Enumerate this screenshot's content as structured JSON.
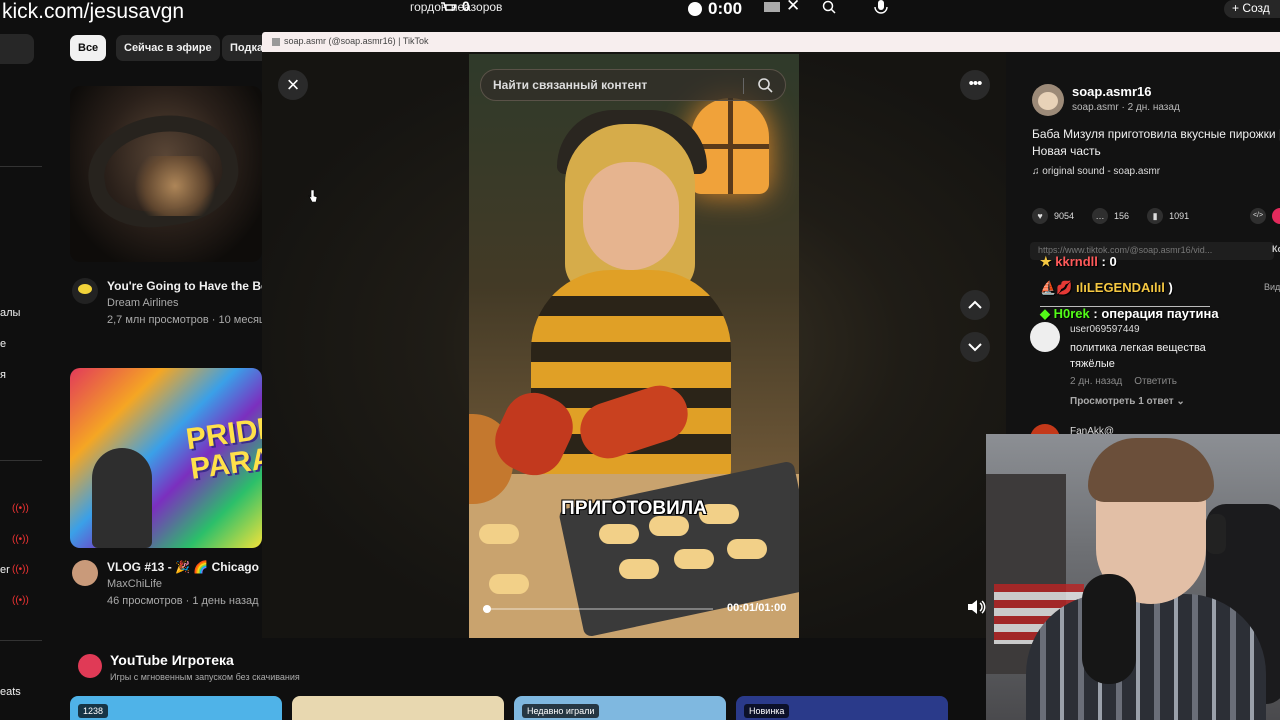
{
  "overlay": {
    "stream_url": "kick.com/jesusavgn",
    "top_text": "гордон неазоров",
    "counter": "0",
    "timer": "0:00",
    "create_label": "Созд"
  },
  "youtube": {
    "chips": [
      "Все",
      "Сейчас в эфире",
      "Подка"
    ],
    "sidebar": [
      "алы",
      "e",
      "я",
      "er",
      "eats"
    ],
    "videos": [
      {
        "title": "You're Going to Have the Bes",
        "channel": "Dream Airlines",
        "meta": "2,7 млн просмотров · 10 месяц"
      },
      {
        "title": "VLOG #13 - 🎉 🌈 Chicago I",
        "channel": "MaxChiLife",
        "meta": "46 просмотров · 1 день назад"
      }
    ],
    "thumb2_text": "PRIDE PARAD",
    "games": {
      "title": "YouTube Игротека",
      "subtitle": "Игры с мгновенным запуском без скачивания",
      "cards": [
        {
          "tag": "1238",
          "color": "#4fb3e8"
        },
        {
          "tag": "",
          "color": "#e8d8b0"
        },
        {
          "tag": "Недавно играли",
          "color": "#7fb8e0"
        },
        {
          "tag": "Новинка",
          "color": "#2a3a8a"
        }
      ]
    }
  },
  "tiktok": {
    "window_title": "soap.asmr (@soap.asmr16) | TikTok",
    "search_placeholder": "Найти связанный контент",
    "caption": "ПРИГОТОВИЛА",
    "progress": 0.017,
    "time": "00:01/01:00",
    "author": {
      "name": "soap.asmr16",
      "meta": "soap.asmr · 2 дн. назад"
    },
    "description": "Баба Мизуля приготовила вкусные пирожки | Новая часть",
    "sound": "original sound - soap.asmr",
    "stats": {
      "likes": "9054",
      "comments": "156",
      "saves": "1091"
    },
    "embed_label": "</>",
    "link": "https://www.tiktok.com/@soap.asmr16/vid...",
    "copy_label": "Ко",
    "side_label": "Вид",
    "comment": {
      "user": "user069597449",
      "text": "политика легкая вещества тяжёлые",
      "time": "2 дн. назад",
      "reply": "Ответить",
      "view_replies": "Просмотреть 1 ответ ⌄"
    },
    "comment2_user": "FanAkk@"
  },
  "chat": [
    {
      "user": "kkrndll",
      "message": ": 0",
      "color": "#ff5a5a",
      "badge": "★"
    },
    {
      "user": "ılıLEGENDAılıl",
      "message": ")",
      "color": "#f5c842",
      "badge": "⛵💋"
    },
    {
      "user": "H0rek",
      "message": ": операция паутина",
      "color": "#53fc18",
      "badge": "◆"
    }
  ]
}
